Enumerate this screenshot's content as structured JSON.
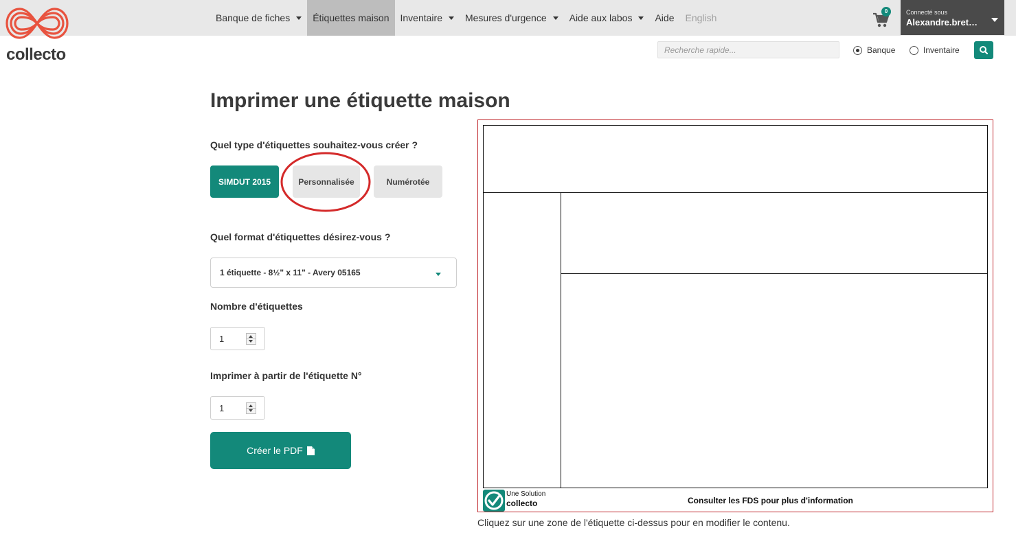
{
  "brand": {
    "name": "collecto"
  },
  "nav": {
    "items": [
      {
        "label": "Banque de fiches",
        "has_caret": true,
        "active": false
      },
      {
        "label": "Étiquettes maison",
        "has_caret": false,
        "active": true
      },
      {
        "label": "Inventaire",
        "has_caret": true,
        "active": false
      },
      {
        "label": "Mesures d'urgence",
        "has_caret": true,
        "active": false
      },
      {
        "label": "Aide aux labos",
        "has_caret": true,
        "active": false
      },
      {
        "label": "Aide",
        "has_caret": false,
        "active": false
      },
      {
        "label": "English",
        "has_caret": false,
        "active": false
      }
    ],
    "cart_icon": "shopping-cart-icon",
    "cart_count": "0"
  },
  "user": {
    "caption": "Connecté sous",
    "name": "Alexandre.bret…"
  },
  "search": {
    "placeholder": "Recherche rapide...",
    "value": "",
    "scope_options": [
      "Banque",
      "Inventaire"
    ],
    "selected_scope": "Banque",
    "button_icon": "magnifier-icon"
  },
  "page": {
    "title": "Imprimer une étiquette maison",
    "type_question": "Quel type d'étiquettes souhaitez-vous créer ?",
    "type_options": [
      "SIMDUT 2015",
      "Personnalisée",
      "Numérotée"
    ],
    "selected_type": "SIMDUT 2015",
    "format_question": "Quel format d'étiquettes désirez-vous ?",
    "format_value": "1 étiquette - 8½\" x 11\" - Avery 05165",
    "count_label": "Nombre d'étiquettes",
    "count_value": "1",
    "start_label": "Imprimer à partir de l'étiquette N°",
    "start_value": "1",
    "create_pdf_label": "Créer le PDF",
    "create_pdf_icon": "file-icon"
  },
  "preview": {
    "solution_small": "Une Solution",
    "solution_brand": "collecto",
    "footer_note": "Consulter les FDS pour plus d'information",
    "hint": "Cliquez sur une zone de l'étiquette ci-dessus pour en modifier le contenu."
  },
  "colors": {
    "accent": "#13897a",
    "nav_bg": "#e8e8e8",
    "nav_active_bg": "#bdbdbd",
    "user_bg": "#4a4a4a",
    "highlight": "#d42a2a",
    "preview_border": "#c0282d"
  }
}
